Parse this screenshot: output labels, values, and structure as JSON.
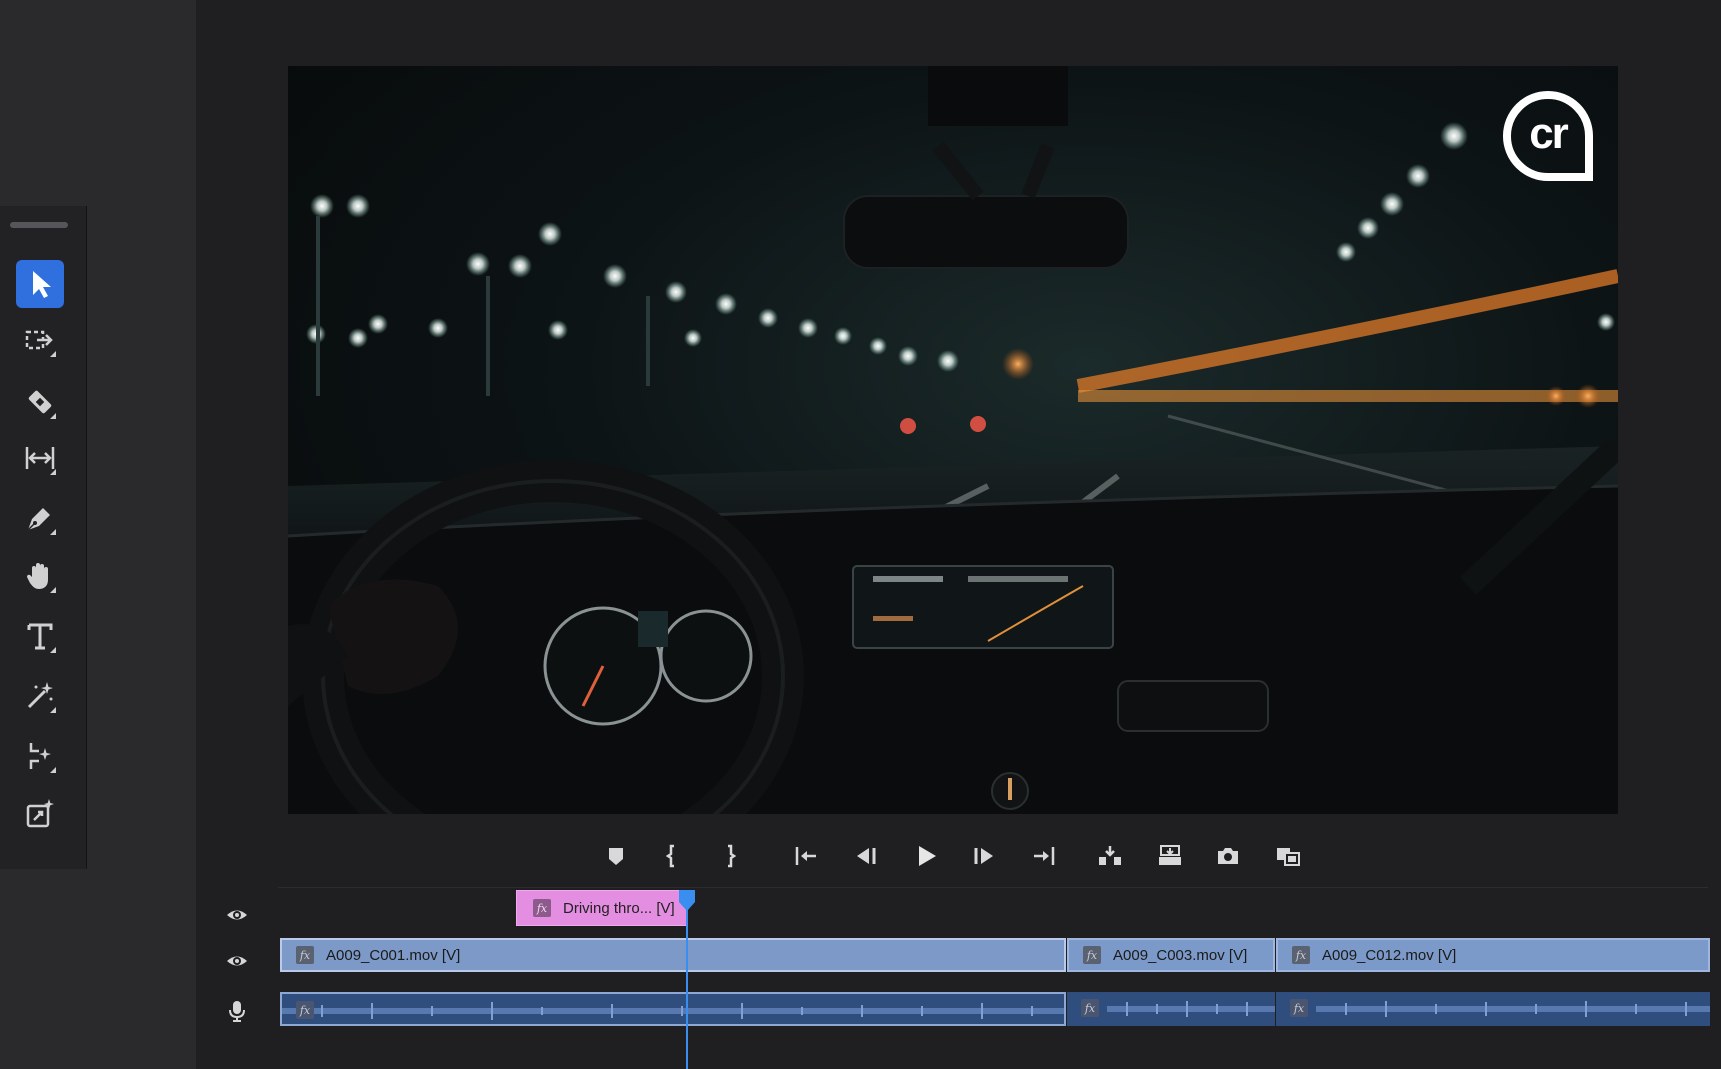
{
  "colors": {
    "accent": "#2f6fde",
    "video_clip": "#7c9ac9",
    "graphic_clip": "#e38ee0",
    "audio_clip": "#2f4e7e",
    "playhead": "#3a8ef0"
  },
  "tools": [
    {
      "name": "selection-tool",
      "icon": "arrow-icon",
      "active": true
    },
    {
      "name": "track-select-forward-tool",
      "icon": "track-select-icon"
    },
    {
      "name": "razor-tool",
      "icon": "razor-icon"
    },
    {
      "name": "slip-tool",
      "icon": "slip-icon"
    },
    {
      "name": "pen-tool",
      "icon": "pen-icon"
    },
    {
      "name": "hand-tool",
      "icon": "hand-icon"
    },
    {
      "name": "type-tool",
      "icon": "type-icon"
    },
    {
      "name": "magic-wand-tool",
      "icon": "magic-wand-icon"
    },
    {
      "name": "remix-tool",
      "icon": "remix-icon"
    },
    {
      "name": "generative-extend-tool",
      "icon": "generative-extend-icon"
    }
  ],
  "monitor": {
    "watermark": "cr"
  },
  "transport": [
    {
      "name": "add-marker-button",
      "icon": "marker-icon"
    },
    {
      "name": "mark-in-button",
      "icon": "mark-in-icon"
    },
    {
      "name": "mark-out-button",
      "icon": "mark-out-icon"
    },
    {
      "name": "go-to-in-button",
      "icon": "go-to-in-icon"
    },
    {
      "name": "step-back-button",
      "icon": "step-back-icon"
    },
    {
      "name": "play-button",
      "icon": "play-icon"
    },
    {
      "name": "step-forward-button",
      "icon": "step-forward-icon"
    },
    {
      "name": "go-to-out-button",
      "icon": "go-to-out-icon"
    },
    {
      "name": "insert-button",
      "icon": "insert-icon"
    },
    {
      "name": "overwrite-button",
      "icon": "overwrite-icon"
    },
    {
      "name": "export-frame-button",
      "icon": "camera-icon"
    },
    {
      "name": "comparison-view-button",
      "icon": "comparison-icon"
    }
  ],
  "timeline": {
    "fx_label": "fx",
    "tracks": [
      {
        "type": "video",
        "toggle_icon": "eye-icon"
      },
      {
        "type": "video",
        "toggle_icon": "eye-icon"
      },
      {
        "type": "audio",
        "toggle_icon": "microphone-icon"
      }
    ],
    "graphic_clip": {
      "label": "Driving thro... [V]"
    },
    "video_clips": [
      {
        "label": "A009_C001.mov [V]"
      },
      {
        "label": "A009_C003.mov [V]"
      },
      {
        "label": "A009_C012.mov [V]"
      }
    ]
  }
}
